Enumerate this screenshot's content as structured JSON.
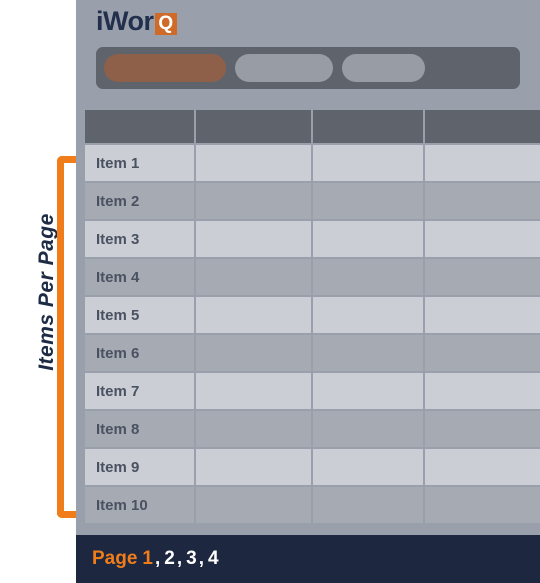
{
  "app": {
    "logo_text": "iWor",
    "logo_badge": "Q"
  },
  "nav": {
    "tabs": [
      {
        "label": "",
        "name": "nav-tab-active",
        "active": true
      },
      {
        "label": "",
        "name": "nav-tab-second",
        "active": false
      },
      {
        "label": "",
        "name": "nav-tab-third",
        "active": false
      }
    ]
  },
  "table": {
    "headers": [
      "",
      "",
      "",
      ""
    ],
    "rows": [
      {
        "item": "Item 1",
        "c2": "",
        "c3": "",
        "c4": ""
      },
      {
        "item": "Item 2",
        "c2": "",
        "c3": "",
        "c4": ""
      },
      {
        "item": "Item 3",
        "c2": "",
        "c3": "",
        "c4": ""
      },
      {
        "item": "Item 4",
        "c2": "",
        "c3": "",
        "c4": ""
      },
      {
        "item": "Item 5",
        "c2": "",
        "c3": "",
        "c4": ""
      },
      {
        "item": "Item 6",
        "c2": "",
        "c3": "",
        "c4": ""
      },
      {
        "item": "Item 7",
        "c2": "",
        "c3": "",
        "c4": ""
      },
      {
        "item": "Item 8",
        "c2": "",
        "c3": "",
        "c4": ""
      },
      {
        "item": "Item 9",
        "c2": "",
        "c3": "",
        "c4": ""
      },
      {
        "item": "Item 10",
        "c2": "",
        "c3": "",
        "c4": ""
      }
    ]
  },
  "pagination": {
    "label": "Page",
    "pages": [
      "1",
      "2",
      "3",
      "4"
    ],
    "current": "1",
    "separator": ","
  },
  "annotation": {
    "label": "Items Per Page"
  },
  "colors": {
    "accent_orange": "#f07d1a",
    "logo_orange": "#cf6a28",
    "navy": "#1d2740",
    "panel_gray": "#9aa0ab",
    "header_gray": "#5f636c",
    "row_light": "#cbced5",
    "row_dark": "#a6aab3",
    "tab_active": "#8f6049",
    "tab_inactive": "#979ca5"
  }
}
